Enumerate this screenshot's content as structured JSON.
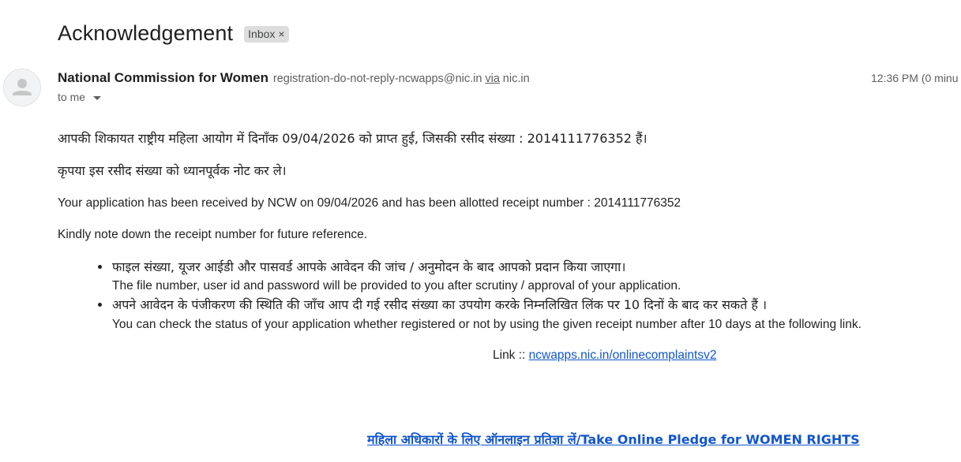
{
  "email": {
    "subject": "Acknowledgement",
    "label_chip": "Inbox",
    "label_chip_remove": "×",
    "sender_name": "National Commission for Women",
    "sender_email": "registration-do-not-reply-ncwapps@nic.in",
    "via_word": "via",
    "via_domain": "nic.in",
    "timestamp": "12:36 PM (0 minu",
    "recipient": "to me"
  },
  "body": {
    "hindi_line_1": "आपकी शिकायत राष्ट्रीय महिला आयोग में दिनाँक 09/04/2026 को प्राप्त हुई, जिसकी रसीद संख्या : 2014111776352 हैं।",
    "hindi_line_2": "कृपया इस रसीद संख्या को ध्यानपूर्वक नोट कर ले।",
    "english_line_1": "Your application has been received by NCW on 09/04/2026 and has been allotted receipt number : 2014111776352",
    "english_line_2": "Kindly note down the receipt number for future reference.",
    "bullets": [
      {
        "hindi": "फाइल संख्या, यूजर आईडी और पासवर्ड आपके आवेदन की जांच / अनुमोदन के बाद आपको प्रदान किया जाएगा।",
        "english": "The file number, user id and password will be provided to you after scrutiny / approval of your application."
      },
      {
        "hindi": "अपने आवेदन के पंजीकरण की स्थिति की जाँच आप दी गई रसीद संख्या का उपयोग करके निम्नलिखित लिंक पर 10 दिनों के बाद कर सकते हैं ।",
        "english": "You can check the status of your application whether registered or not by using the given receipt number after 10 days at the following link."
      }
    ],
    "link_prefix": "Link :: ",
    "link_text": "ncwapps.nic.in/onlinecomplaintsv2",
    "pledge_link": "महिला अधिकारों के लिए ऑनलाइन प्रतिज्ञा लें/Take Online Pledge for WOMEN RIGHTS"
  },
  "colors": {
    "link": "#1155cc",
    "chip_bg": "#dddddd",
    "muted": "#5e5e5e"
  }
}
